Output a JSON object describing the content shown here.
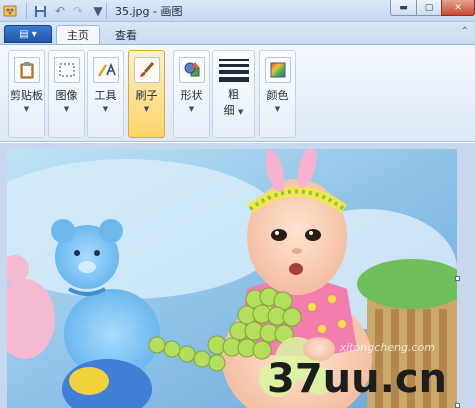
{
  "window": {
    "title": "35.jpg - 画图"
  },
  "quick_access": {
    "app_icon": "paint-app-icon",
    "save": "save-icon",
    "undo": "undo-icon",
    "redo": "redo-icon",
    "more": "customize-arrow-icon"
  },
  "tabs": [
    {
      "label": "主页",
      "active": true
    },
    {
      "label": "查看",
      "active": false
    }
  ],
  "ribbon": {
    "groups": [
      {
        "label": "剪贴板",
        "icon": "clipboard-icon"
      },
      {
        "label": "图像",
        "icon": "select-icon"
      },
      {
        "label": "工具",
        "icon": "tools-icon"
      },
      {
        "label": "刷子",
        "icon": "brush-icon",
        "active": true
      },
      {
        "label": "形状",
        "icon": "shapes-icon"
      },
      {
        "label": "粗",
        "label2": "细",
        "icon": "line-width-icon"
      },
      {
        "label": "颜色",
        "icon": "color-icon"
      }
    ]
  },
  "watermark": {
    "main": "37uu.cn",
    "faint": "xitongcheng.com"
  },
  "colors": {
    "ribbon_active": "#fbd46a",
    "app_button": "#2b64b8",
    "close_button": "#c6492f"
  }
}
